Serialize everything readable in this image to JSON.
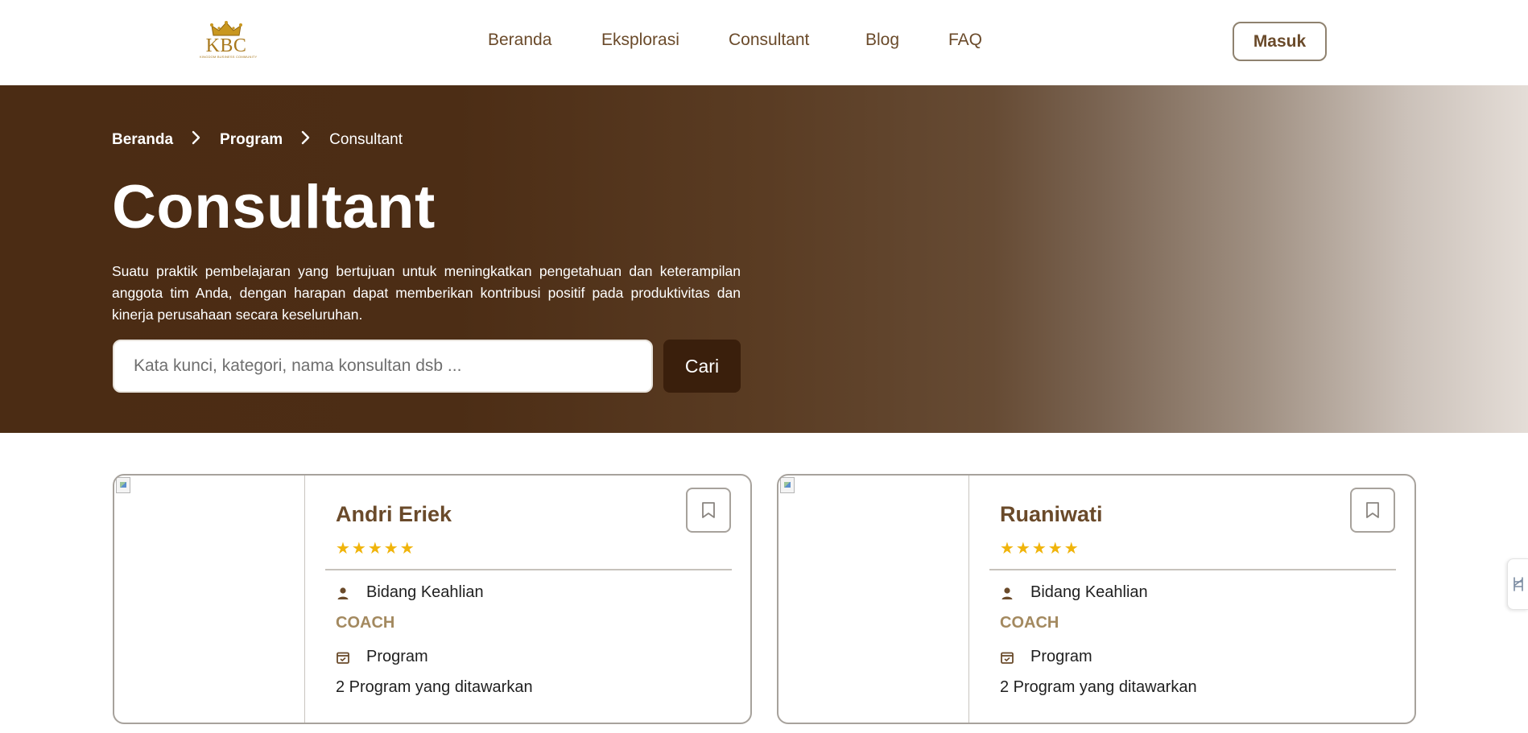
{
  "header": {
    "logo": {
      "text": "KBC",
      "tagline": "KINGDOM BUSINESS COMMUNITY"
    },
    "nav": [
      {
        "label": "Beranda"
      },
      {
        "label": "Eksplorasi"
      },
      {
        "label": "Consultant"
      },
      {
        "label": "Blog"
      },
      {
        "label": "FAQ"
      }
    ],
    "login_label": "Masuk"
  },
  "hero": {
    "breadcrumb": [
      "Beranda",
      "Program",
      "Consultant"
    ],
    "title": "Consultant",
    "description": "Suatu praktik pembelajaran yang bertujuan untuk meningkatkan pengetahuan dan keterampilan anggota tim Anda, dengan harapan dapat memberikan kontribusi positif pada produktivitas dan kinerja perusahaan secara keseluruhan.",
    "search": {
      "placeholder": "Kata kunci, kategori, nama konsultan dsb ...",
      "value": "",
      "button_label": "Cari"
    }
  },
  "consultants": [
    {
      "name": "Andri Eriek",
      "rating": 5,
      "stars": "★★★★★",
      "expertise_label": "Bidang Keahlian",
      "expertise_value": "COACH",
      "program_label": "Program",
      "program_count": "2 Program yang ditawarkan"
    },
    {
      "name": "Ruaniwati",
      "rating": 5,
      "stars": "★★★★★",
      "expertise_label": "Bidang Keahlian",
      "expertise_value": "COACH",
      "program_label": "Program",
      "program_count": "2 Program yang ditawarkan"
    }
  ],
  "icons": {
    "breadcrumb_separator": "chevron-right-icon",
    "bookmark": "bookmark-icon",
    "expertise": "person-icon",
    "program": "calendar-check-icon",
    "side_tab": "accessibility-icon"
  },
  "colors": {
    "brand_brown": "#6a4a2a",
    "hero_dark": "#4b2c14",
    "search_button": "#3a1f0c",
    "star": "#f0b40b",
    "expertise_text": "#a3895f",
    "logo_gold": "#a8781c"
  }
}
